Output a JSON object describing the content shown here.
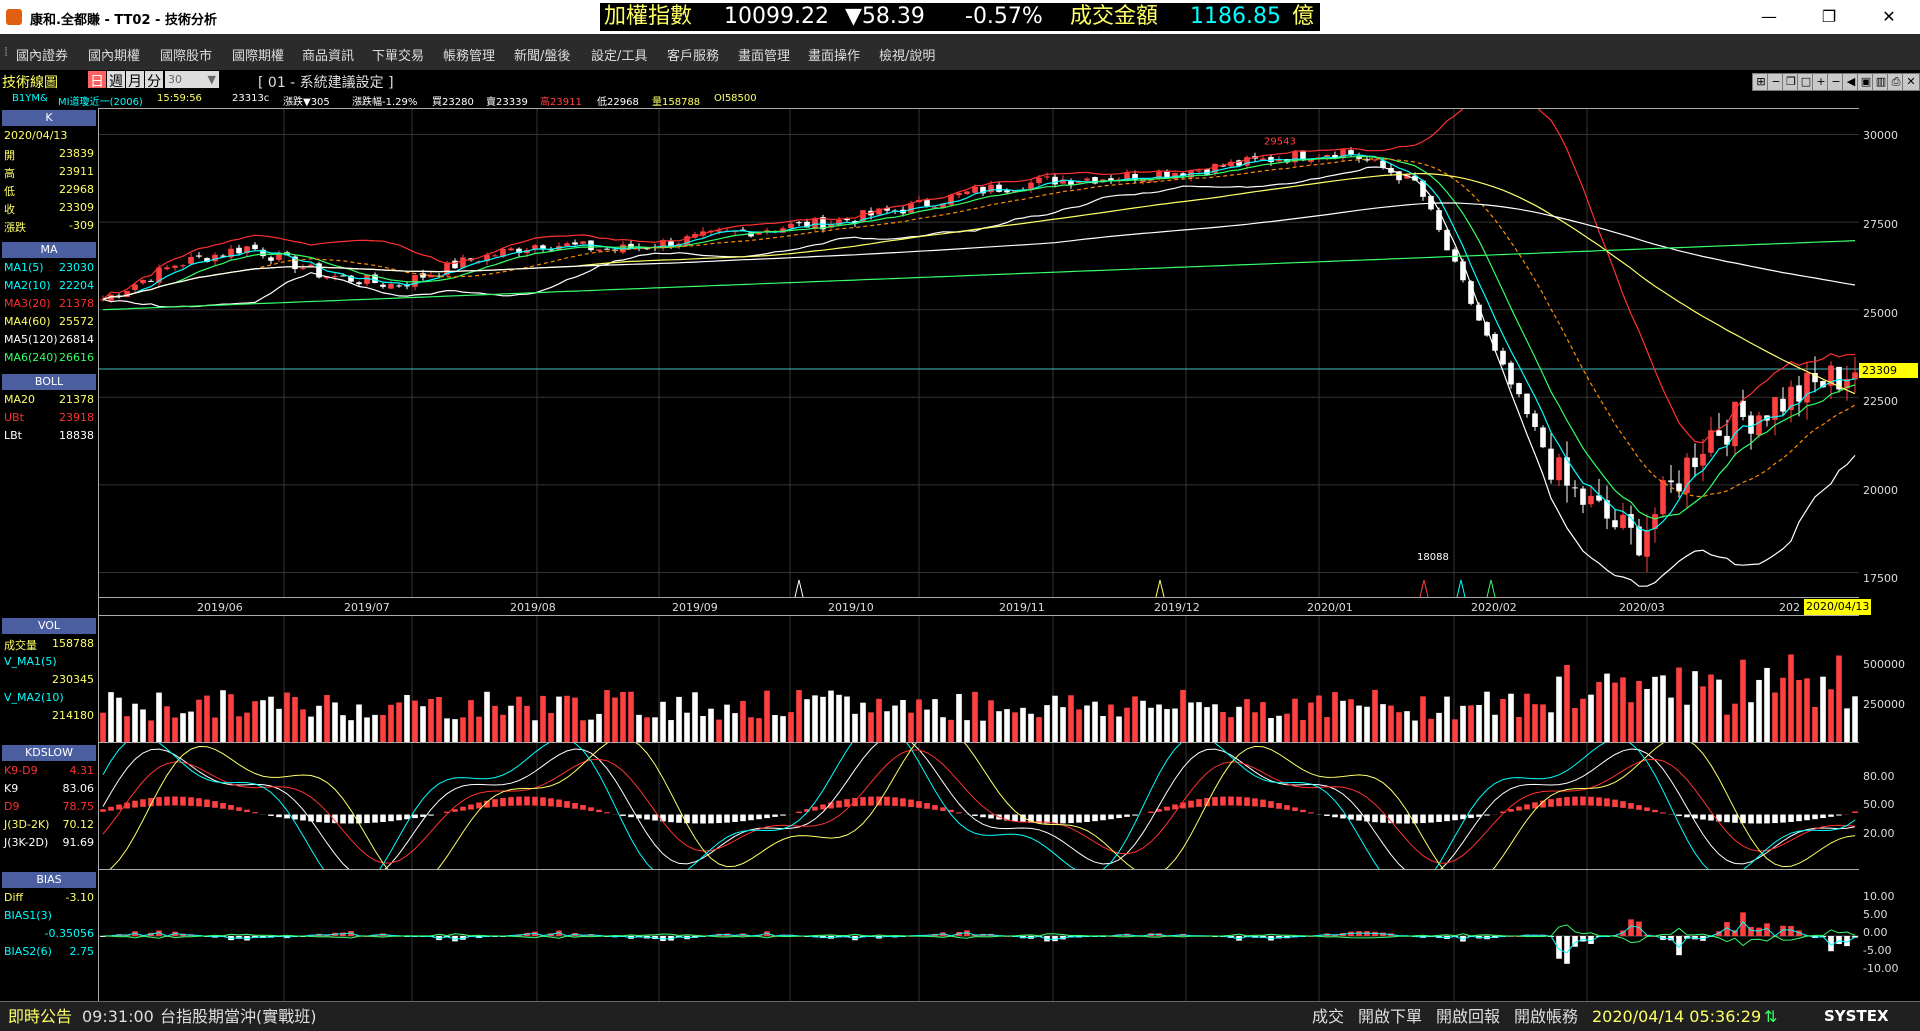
{
  "window": {
    "title": "康和.全都賺 - TT02 - 技術分析",
    "minimize": "—",
    "maximize": "❐",
    "close": "✕"
  },
  "ticker": {
    "index_label": "加權指數",
    "index_value": "10099.22",
    "change": "▼58.39",
    "change_pct": "-0.57%",
    "turnover_label": "成交金額",
    "turnover_value": "1186.85",
    "unit": "億"
  },
  "menu": [
    "國內證券",
    "國內期權",
    "國際股市",
    "國際期權",
    "商品資訊",
    "下單交易",
    "帳務管理",
    "新聞/盤後",
    "設定/工具",
    "客戶服務",
    "畫面管理",
    "畫面操作",
    "檢視/說明"
  ],
  "header": {
    "panel_title": "技術線圖",
    "periods": [
      "日",
      "週",
      "月",
      "分"
    ],
    "minute_value": "30",
    "setting_name": "[ 01 - 系統建議設定 ]",
    "symbol": "B1YM&",
    "symbol_desc": "MI道瓊近一(2006)",
    "time": "15:59:56",
    "last": "23313c",
    "change": "漲跌▼305",
    "change_pct": "漲跌幅-1.29%",
    "bid": "買23280",
    "ask": "賣23339",
    "high": "高23911",
    "low": "低22968",
    "volume": "量158788",
    "oi": "OI58500"
  },
  "toolbar_icons": [
    "fullscreen-icon",
    "minimize-panel-icon",
    "restore-panel-icon",
    "maximize-panel-icon",
    "zoom-in-icon",
    "zoom-out-icon",
    "prev-icon",
    "save-icon",
    "chart-type-icon",
    "print-icon",
    "close-panel-icon"
  ],
  "sidebar": {
    "k": {
      "head": "K",
      "date": "2020/04/13",
      "rows": [
        {
          "label": "開",
          "value": "23839",
          "color": "#ffff66"
        },
        {
          "label": "高",
          "value": "23911",
          "color": "#ffff66"
        },
        {
          "label": "低",
          "value": "22968",
          "color": "#ffff66"
        },
        {
          "label": "收",
          "value": "23309",
          "color": "#ffff66"
        },
        {
          "label": "漲跌",
          "value": "-309",
          "color": "#ffff66"
        }
      ]
    },
    "ma": {
      "head": "MA",
      "rows": [
        {
          "label": "MA1(5)",
          "value": "23030",
          "color": "#00ffff"
        },
        {
          "label": "MA2(10)",
          "value": "22204",
          "color": "#00ffff"
        },
        {
          "label": "MA3(20)",
          "value": "21378",
          "color": "#ff3030"
        },
        {
          "label": "MA4(60)",
          "value": "25572",
          "color": "#ffff66"
        },
        {
          "label": "MA5(120)",
          "value": "26814",
          "color": "#ffffff"
        },
        {
          "label": "MA6(240)",
          "value": "26616",
          "color": "#33ff66"
        }
      ]
    },
    "boll": {
      "head": "BOLL",
      "rows": [
        {
          "label": "MA20",
          "value": "21378",
          "color": "#ffff66"
        },
        {
          "label": "UBt",
          "value": "23918",
          "color": "#ff3030"
        },
        {
          "label": "LBt",
          "value": "18838",
          "color": "#ffffff"
        }
      ]
    },
    "vol": {
      "head": "VOL",
      "rows": [
        {
          "label": "成交量",
          "value": "158788",
          "color": "#ffff66"
        },
        {
          "label": "V_MA1(5)",
          "value": "",
          "color": "#00ffff"
        },
        {
          "label": "",
          "value": "230345",
          "color": "#ffff66"
        },
        {
          "label": "V_MA2(10)",
          "value": "",
          "color": "#00ffff"
        },
        {
          "label": "",
          "value": "214180",
          "color": "#ffff66"
        }
      ]
    },
    "kd": {
      "head": "KDSLOW",
      "rows": [
        {
          "label": "K9-D9",
          "value": "4.31",
          "color": "#ff3030"
        },
        {
          "label": "K9",
          "value": "83.06",
          "color": "#ffffff"
        },
        {
          "label": "D9",
          "value": "78.75",
          "color": "#ff3030"
        },
        {
          "label": "J(3D-2K)",
          "value": "70.12",
          "color": "#ffff66"
        },
        {
          "label": "J(3K-2D)",
          "value": "91.69",
          "color": "#ffffff"
        }
      ]
    },
    "bias": {
      "head": "BIAS",
      "rows": [
        {
          "label": "Diff",
          "value": "-3.10",
          "color": "#ffff66"
        },
        {
          "label": "BIAS1(3)",
          "value": "",
          "color": "#00ffff"
        },
        {
          "label": "",
          "value": "-0.35056",
          "color": "#00ffff"
        },
        {
          "label": "BIAS2(6)",
          "value": "2.75",
          "color": "#00ffff"
        }
      ]
    }
  },
  "yaxis": {
    "price": [
      "30000",
      "27500",
      "25000",
      "22500",
      "20000",
      "17500"
    ],
    "last_price_tag": "23309",
    "volume": [
      "500000",
      "250000"
    ],
    "kd": [
      "80.00",
      "50.00",
      "20.00"
    ],
    "bias": [
      "10.00",
      "5.00",
      "0.00",
      "-5.00",
      "-10.00"
    ]
  },
  "annotations": {
    "high_label": "29543",
    "low_label": "18088"
  },
  "dates": [
    "2019/06",
    "2019/07",
    "2019/08",
    "2019/09",
    "2019/10",
    "2019/11",
    "2019/12",
    "2020/01",
    "2020/02",
    "2020/03",
    "202"
  ],
  "date_cursor": "2020/04/13",
  "colors": {
    "up": "#ff4040",
    "down": "#ffffff",
    "ma5": "#00ffff",
    "ma10": "#33ff66",
    "ma20": "#ff8c00",
    "ma60": "#ffff66",
    "ma120": "#ffffff",
    "ma240": "#33ff66",
    "boll_up": "#ff3030",
    "boll_low": "#ffffff"
  },
  "status": {
    "label": "即時公告",
    "time": "09:31:00",
    "news": "台指股期當沖(實戰班)",
    "buttons": [
      "成交",
      "開啟下單",
      "開啟回報",
      "開啟帳務"
    ],
    "datetime": "2020/04/14 05:36:29",
    "brand": "SYSTEX"
  },
  "chart_data": {
    "type": "candlestick",
    "instrument": "B1YM&",
    "x": [
      "2019/06",
      "2019/07",
      "2019/08",
      "2019/09",
      "2019/10",
      "2019/11",
      "2019/12",
      "2020/01",
      "2020/02",
      "2020/03",
      "2020/04"
    ],
    "close": [
      25300,
      26800,
      26100,
      26900,
      27000,
      27500,
      28400,
      28800,
      29300,
      21500,
      23309
    ],
    "high_marker": 29543,
    "low_marker": 18088,
    "last": 23309,
    "ylim": [
      17000,
      30500
    ]
  }
}
